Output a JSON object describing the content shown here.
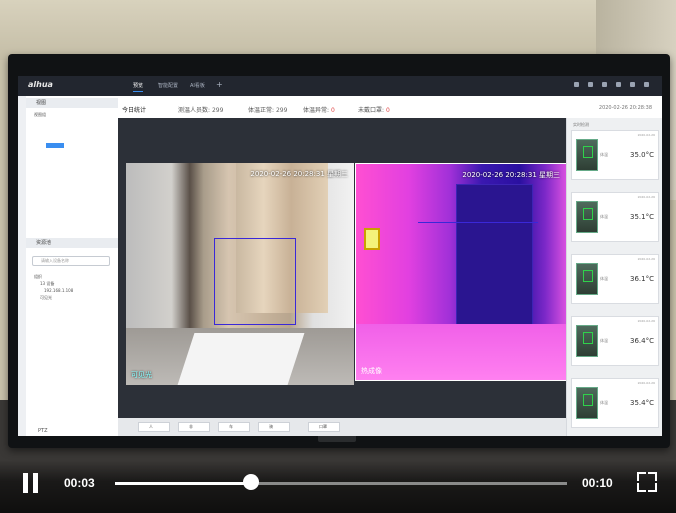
{
  "app": {
    "logo": "alhua",
    "tabs": [
      {
        "label": "预览",
        "active": true
      },
      {
        "label": "智能配置",
        "active": false
      },
      {
        "label": "AI看板",
        "active": false
      }
    ],
    "add_tab": "+"
  },
  "sidebar": {
    "section1": "视图",
    "tree_root": "视图组",
    "section2": "资源池",
    "search_placeholder": "请输入设备名称",
    "device_root": "组织",
    "device_child": "13 设备",
    "device_ip": "192.168.1.108",
    "channel": "可见光",
    "ptz": "PTZ"
  },
  "stats": {
    "title": "今日统计",
    "total_label": "测温人员数:",
    "total_value": "299",
    "normal_label": "体温正常:",
    "normal_value": "299",
    "abnormal_label": "体温异常:",
    "abnormal_value": "0",
    "nomask_label": "未戴口罩:",
    "nomask_value": "0",
    "datetime": "2020-02-26 20:28:38"
  },
  "video": {
    "visible_timestamp": "2020-02-26 20:28:31 星期三",
    "visible_label": "可见光",
    "thermal_timestamp": "2020-02-26 20:28:31 星期三",
    "thermal_label": "热成像"
  },
  "records": {
    "title": "实时检测",
    "items": [
      {
        "temp": "35.0°C",
        "label": "体温",
        "date": "2020-02-26"
      },
      {
        "temp": "35.1°C",
        "label": "体温",
        "date": "2020-02-26"
      },
      {
        "temp": "36.1°C",
        "label": "体温",
        "date": "2020-02-26"
      },
      {
        "temp": "36.4°C",
        "label": "体温",
        "date": "2020-02-26"
      },
      {
        "temp": "35.4°C",
        "label": "体温",
        "date": "2020-02-26"
      }
    ]
  },
  "bottom_tools": [
    "人",
    "非",
    "车",
    "骑",
    "口罩"
  ],
  "player": {
    "current_time": "00:03",
    "total_time": "00:10",
    "progress": 0.3
  }
}
